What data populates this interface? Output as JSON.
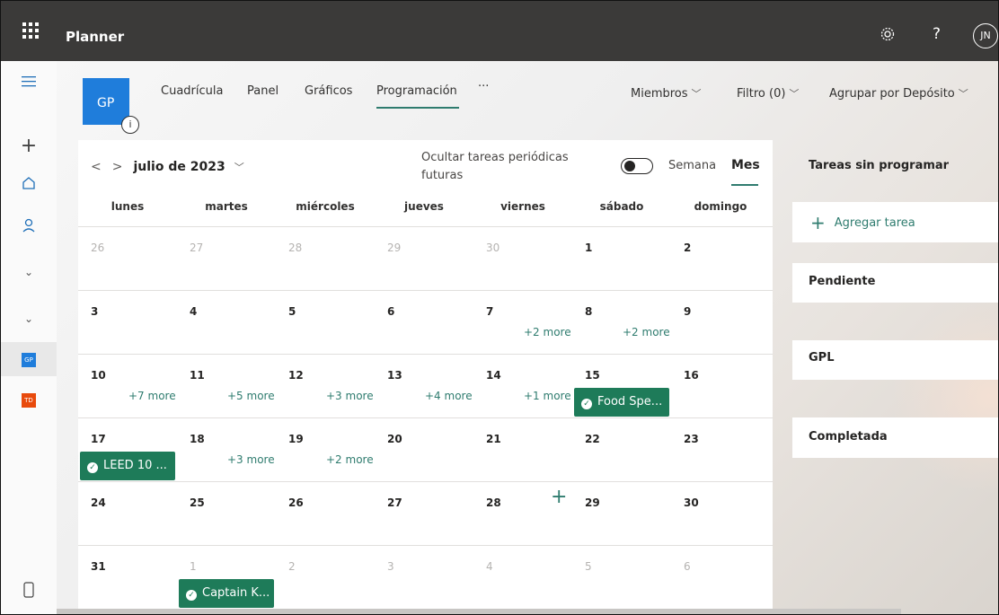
{
  "app": {
    "title": "Planner",
    "user_initials": "JN",
    "settings_icon": "gear-icon",
    "help_label": "?"
  },
  "rail": {
    "items": [
      "menu-icon",
      "plus-icon",
      "home-icon",
      "person-icon",
      "chevron-down-icon",
      "chevron-down-icon"
    ],
    "plans": [
      {
        "initials": "GP",
        "color": "#1f7ddb"
      },
      {
        "initials": "TD",
        "color": "#e84a0c"
      }
    ]
  },
  "plan": {
    "initials": "GP",
    "color": "#1f7ddb",
    "info_label": "i"
  },
  "tabs": [
    "Cuadrícula",
    "Panel",
    "Gráficos",
    "Programación",
    "···"
  ],
  "active_tab": "Programación",
  "header_right": {
    "members": "Miembros",
    "filter": "Filtro (0)",
    "group_by": "Agrupar por Depósito"
  },
  "calendar": {
    "month_label": "julio de 2023",
    "periodic_label": "Ocultar tareas periódicas futuras",
    "view_week": "Semana",
    "view_month": "Mes",
    "weekdays": [
      "lunes",
      "martes",
      "miércoles",
      "jueves",
      "viernes",
      "sábado",
      "domingo"
    ],
    "weeks": [
      [
        {
          "d": "26",
          "faded": true
        },
        {
          "d": "27",
          "faded": true
        },
        {
          "d": "28",
          "faded": true
        },
        {
          "d": "29",
          "faded": true
        },
        {
          "d": "30",
          "faded": true
        },
        {
          "d": "1"
        },
        {
          "d": "2"
        }
      ],
      [
        {
          "d": "3"
        },
        {
          "d": "4"
        },
        {
          "d": "5"
        },
        {
          "d": "6"
        },
        {
          "d": "7",
          "more": "+2 more"
        },
        {
          "d": "8",
          "more": "+2 more"
        },
        {
          "d": "9"
        }
      ],
      [
        {
          "d": "10",
          "more": "+7 more"
        },
        {
          "d": "11",
          "more": "+5 more"
        },
        {
          "d": "12",
          "more": "+3 more"
        },
        {
          "d": "13",
          "more": "+4 more"
        },
        {
          "d": "14",
          "more": "+1 more"
        },
        {
          "d": "15"
        },
        {
          "d": "16"
        }
      ],
      [
        {
          "d": "17"
        },
        {
          "d": "18",
          "more": "+3 more"
        },
        {
          "d": "19",
          "more": "+2 more"
        },
        {
          "d": "20"
        },
        {
          "d": "21"
        },
        {
          "d": "22"
        },
        {
          "d": "23"
        }
      ],
      [
        {
          "d": "24"
        },
        {
          "d": "25"
        },
        {
          "d": "26"
        },
        {
          "d": "27"
        },
        {
          "d": "28"
        },
        {
          "d": "29"
        },
        {
          "d": "30"
        }
      ],
      [
        {
          "d": "31"
        },
        {
          "d": "1",
          "faded": true
        },
        {
          "d": "2",
          "faded": true
        },
        {
          "d": "3",
          "faded": true
        },
        {
          "d": "4",
          "faded": true
        },
        {
          "d": "5",
          "faded": true
        },
        {
          "d": "6",
          "faded": true
        }
      ]
    ],
    "tasks": [
      {
        "label": "Food Spe...",
        "week": 2,
        "col": 5
      },
      {
        "label": "LEED 10 ...",
        "week": 3,
        "col": 0
      },
      {
        "label": "Captain K...",
        "week": 5,
        "col": 1
      }
    ],
    "add_in_cell": "+"
  },
  "side": {
    "unscheduled_title": "Tareas sin programar",
    "add_task": "Agregar tarea",
    "buckets": [
      "Pendiente",
      "GPL",
      "Completada"
    ]
  }
}
